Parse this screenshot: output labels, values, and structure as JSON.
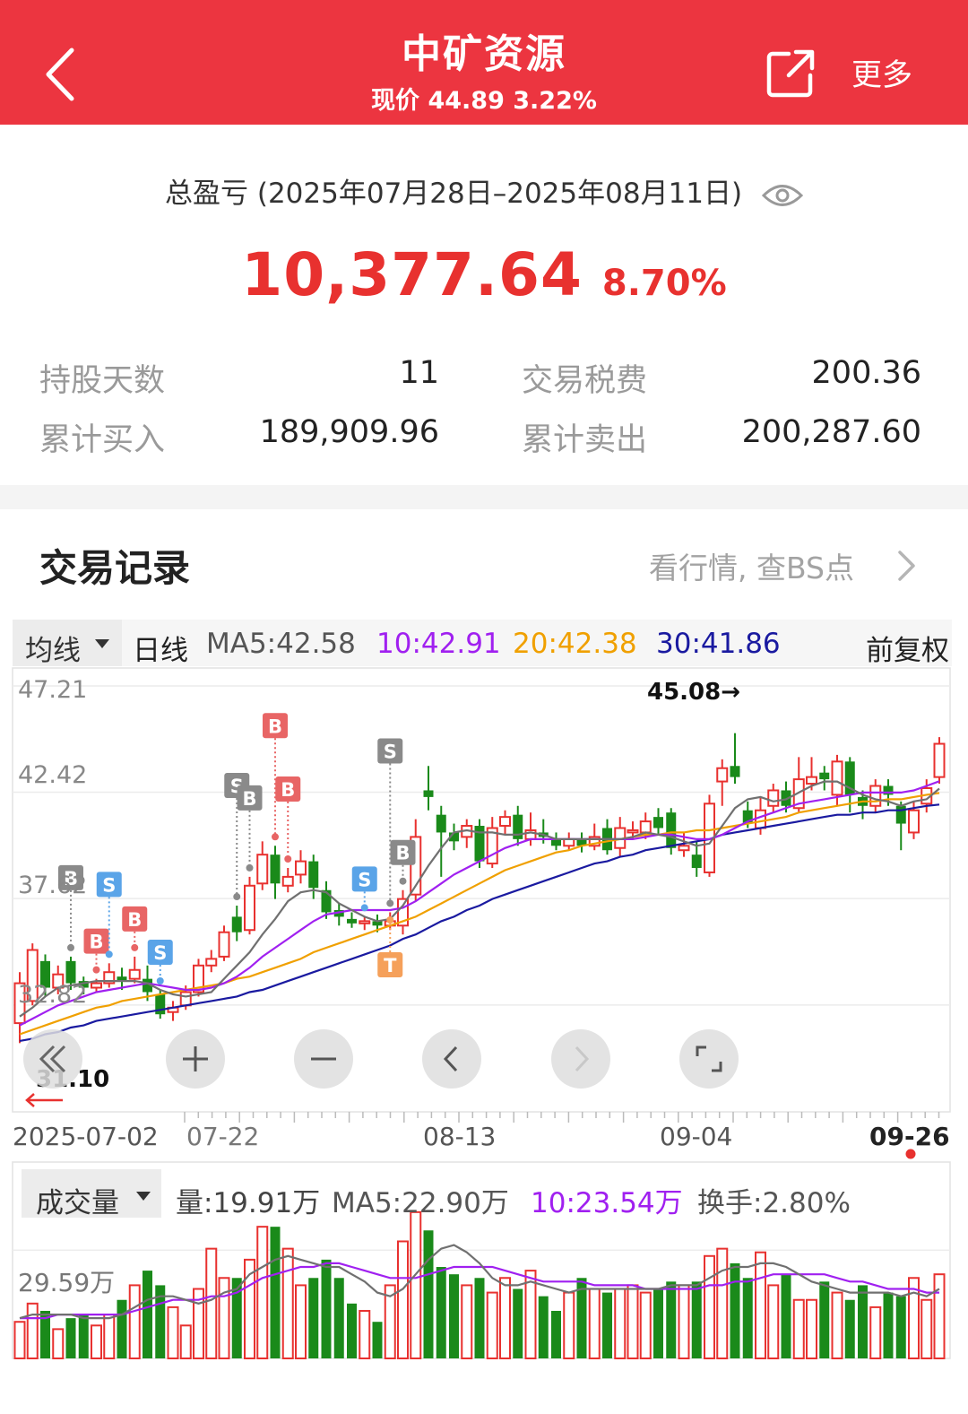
{
  "header": {
    "title": "中矿资源",
    "subtitle": "现价 44.89 3.22%",
    "more_label": "更多"
  },
  "summary": {
    "range_label": "总盈亏 (2025年07月28日–2025年08月11日)",
    "amount": "10,377.64",
    "percent": "8.70%",
    "stats": [
      {
        "label": "持股天数",
        "value": "11"
      },
      {
        "label": "交易税费",
        "value": "200.36"
      },
      {
        "label": "累计买入",
        "value": "189,909.96"
      },
      {
        "label": "累计卖出",
        "value": "200,287.60"
      }
    ]
  },
  "trades": {
    "title": "交易记录",
    "link_label": "看行情, 查BS点"
  },
  "kline": {
    "ma_selector": "均线",
    "period": "日线",
    "ma5": "MA5:42.58",
    "ma10": "10:42.91",
    "ma20": "20:42.38",
    "ma30": "30:41.86",
    "adjust": "前复权",
    "y_labels": [
      "47.21",
      "42.42",
      "37.62",
      "32.82"
    ],
    "low_label": "31.10",
    "high_label": "45.08→",
    "x_labels": [
      "2025-07-02",
      "07-22",
      "08-13",
      "09-04",
      "09-26"
    ],
    "colors": {
      "up": "#e8312f",
      "down": "#1a8a1a",
      "ma5": "#707070",
      "ma10": "#a020f0",
      "ma20": "#f0a000",
      "ma30": "#1a1aa0",
      "buy": "#e86565",
      "sell": "#5aa4e8",
      "gray": "#8a8a8a",
      "tag_t": "#f5a05a"
    },
    "chart_data": {
      "type": "candlestick",
      "y_range": [
        28.0,
        47.21
      ],
      "high": 45.08,
      "low": 31.1,
      "candles": [
        {
          "o": 32.0,
          "c": 33.8,
          "h": 34.3,
          "l": 31.1
        },
        {
          "o": 33.0,
          "c": 35.3,
          "h": 35.6,
          "l": 32.8
        },
        {
          "o": 34.8,
          "c": 33.6,
          "h": 35.1,
          "l": 33.2
        },
        {
          "o": 33.6,
          "c": 34.2,
          "h": 34.6,
          "l": 33.3
        },
        {
          "o": 34.8,
          "c": 33.8,
          "h": 35.0,
          "l": 33.5
        },
        {
          "o": 33.9,
          "c": 33.6,
          "h": 34.1,
          "l": 33.3
        },
        {
          "o": 33.6,
          "c": 33.8,
          "h": 34.0,
          "l": 33.4
        },
        {
          "o": 33.8,
          "c": 34.3,
          "h": 34.7,
          "l": 33.6
        },
        {
          "o": 34.1,
          "c": 33.9,
          "h": 34.5,
          "l": 33.5
        },
        {
          "o": 34.0,
          "c": 34.4,
          "h": 35.0,
          "l": 33.8
        },
        {
          "o": 34.0,
          "c": 33.4,
          "h": 34.6,
          "l": 33.0
        },
        {
          "o": 33.3,
          "c": 32.4,
          "h": 33.5,
          "l": 32.2
        },
        {
          "o": 32.5,
          "c": 32.7,
          "h": 33.0,
          "l": 32.1
        },
        {
          "o": 32.8,
          "c": 33.4,
          "h": 33.7,
          "l": 32.6
        },
        {
          "o": 33.4,
          "c": 34.6,
          "h": 34.9,
          "l": 33.2
        },
        {
          "o": 34.6,
          "c": 34.9,
          "h": 35.3,
          "l": 34.3
        },
        {
          "o": 35.0,
          "c": 36.1,
          "h": 36.4,
          "l": 34.8
        },
        {
          "o": 36.8,
          "c": 36.1,
          "h": 37.3,
          "l": 35.7
        },
        {
          "o": 36.2,
          "c": 38.2,
          "h": 38.6,
          "l": 36.0
        },
        {
          "o": 38.3,
          "c": 39.6,
          "h": 40.2,
          "l": 38.0
        },
        {
          "o": 39.6,
          "c": 38.3,
          "h": 40.0,
          "l": 37.6
        },
        {
          "o": 38.2,
          "c": 38.6,
          "h": 39.0,
          "l": 37.9
        },
        {
          "o": 38.7,
          "c": 39.3,
          "h": 39.8,
          "l": 38.3
        },
        {
          "o": 39.3,
          "c": 38.1,
          "h": 39.6,
          "l": 37.6
        },
        {
          "o": 38.0,
          "c": 37.0,
          "h": 38.4,
          "l": 36.7
        },
        {
          "o": 37.1,
          "c": 36.8,
          "h": 37.4,
          "l": 36.4
        },
        {
          "o": 36.7,
          "c": 36.5,
          "h": 37.0,
          "l": 36.3
        },
        {
          "o": 36.5,
          "c": 36.6,
          "h": 36.8,
          "l": 36.2
        },
        {
          "o": 36.6,
          "c": 36.4,
          "h": 36.9,
          "l": 36.1
        },
        {
          "o": 36.4,
          "c": 36.6,
          "h": 37.0,
          "l": 36.2
        },
        {
          "o": 36.4,
          "c": 37.6,
          "h": 38.0,
          "l": 36.0
        },
        {
          "o": 37.8,
          "c": 40.4,
          "h": 41.2,
          "l": 37.5
        },
        {
          "o": 42.5,
          "c": 42.2,
          "h": 43.6,
          "l": 41.6
        },
        {
          "o": 41.4,
          "c": 40.6,
          "h": 41.8,
          "l": 38.6
        },
        {
          "o": 40.6,
          "c": 40.2,
          "h": 41.0,
          "l": 39.8
        },
        {
          "o": 40.4,
          "c": 40.9,
          "h": 41.2,
          "l": 39.9
        },
        {
          "o": 40.9,
          "c": 39.3,
          "h": 41.2,
          "l": 39.0
        },
        {
          "o": 39.2,
          "c": 40.8,
          "h": 41.3,
          "l": 39.0
        },
        {
          "o": 40.9,
          "c": 41.3,
          "h": 41.6,
          "l": 40.5
        },
        {
          "o": 41.4,
          "c": 40.3,
          "h": 41.8,
          "l": 40.0
        },
        {
          "o": 40.3,
          "c": 40.7,
          "h": 41.5,
          "l": 40.0
        },
        {
          "o": 40.6,
          "c": 40.4,
          "h": 41.2,
          "l": 40.1
        },
        {
          "o": 40.3,
          "c": 40.0,
          "h": 40.6,
          "l": 39.8
        },
        {
          "o": 40.0,
          "c": 40.3,
          "h": 40.6,
          "l": 39.8
        },
        {
          "o": 40.3,
          "c": 40.0,
          "h": 40.6,
          "l": 39.7
        },
        {
          "o": 40.0,
          "c": 40.4,
          "h": 41.0,
          "l": 39.8
        },
        {
          "o": 40.8,
          "c": 39.8,
          "h": 41.2,
          "l": 39.6
        },
        {
          "o": 39.9,
          "c": 40.8,
          "h": 41.3,
          "l": 39.5
        },
        {
          "o": 40.6,
          "c": 40.7,
          "h": 41.1,
          "l": 40.3
        },
        {
          "o": 40.6,
          "c": 41.1,
          "h": 41.5,
          "l": 40.3
        },
        {
          "o": 41.3,
          "c": 40.8,
          "h": 41.7,
          "l": 40.5
        },
        {
          "o": 41.5,
          "c": 39.9,
          "h": 41.7,
          "l": 39.6
        },
        {
          "o": 39.8,
          "c": 40.0,
          "h": 40.6,
          "l": 39.5
        },
        {
          "o": 39.6,
          "c": 39.0,
          "h": 40.2,
          "l": 38.6
        },
        {
          "o": 38.8,
          "c": 41.9,
          "h": 42.3,
          "l": 38.6
        },
        {
          "o": 42.9,
          "c": 43.5,
          "h": 43.9,
          "l": 41.8
        },
        {
          "o": 43.6,
          "c": 43.1,
          "h": 45.08,
          "l": 42.8
        },
        {
          "o": 41.6,
          "c": 41.0,
          "h": 42.0,
          "l": 40.8
        },
        {
          "o": 40.8,
          "c": 41.6,
          "h": 42.2,
          "l": 40.5
        },
        {
          "o": 41.8,
          "c": 42.5,
          "h": 42.8,
          "l": 41.5
        },
        {
          "o": 42.5,
          "c": 41.8,
          "h": 42.9,
          "l": 41.5
        },
        {
          "o": 41.7,
          "c": 43.0,
          "h": 44.0,
          "l": 41.5
        },
        {
          "o": 42.8,
          "c": 43.1,
          "h": 44.0,
          "l": 42.5
        },
        {
          "o": 43.3,
          "c": 43.0,
          "h": 43.6,
          "l": 42.5
        },
        {
          "o": 42.3,
          "c": 43.8,
          "h": 44.1,
          "l": 41.8
        },
        {
          "o": 43.8,
          "c": 42.3,
          "h": 44.0,
          "l": 41.5
        },
        {
          "o": 42.2,
          "c": 41.8,
          "h": 42.5,
          "l": 41.2
        },
        {
          "o": 41.8,
          "c": 42.7,
          "h": 43.0,
          "l": 41.5
        },
        {
          "o": 42.7,
          "c": 42.3,
          "h": 43.0,
          "l": 41.8
        },
        {
          "o": 41.8,
          "c": 41.0,
          "h": 42.0,
          "l": 39.8
        },
        {
          "o": 40.6,
          "c": 41.6,
          "h": 42.0,
          "l": 40.3
        },
        {
          "o": 41.9,
          "c": 42.6,
          "h": 43.0,
          "l": 41.5
        },
        {
          "o": 43.1,
          "c": 44.6,
          "h": 44.9,
          "l": 42.8
        }
      ],
      "ma5": [
        32.3,
        32.7,
        33.2,
        33.6,
        33.7,
        33.8,
        33.9,
        33.9,
        33.9,
        33.9,
        33.8,
        33.5,
        33.3,
        33.2,
        33.3,
        33.4,
        34.0,
        34.6,
        35.2,
        36.0,
        36.7,
        37.5,
        37.9,
        38.0,
        37.9,
        37.4,
        37.1,
        36.8,
        36.6,
        36.7,
        37.3,
        38.2,
        39.1,
        39.9,
        40.6,
        40.7,
        40.6,
        40.6,
        40.5,
        40.5,
        40.6,
        40.5,
        40.3,
        40.3,
        40.3,
        40.3,
        40.3,
        40.3,
        40.4,
        40.6,
        40.5,
        40.4,
        40.2,
        40.0,
        40.1,
        40.9,
        41.7,
        42.1,
        42.2,
        42.0,
        42.1,
        42.4,
        42.7,
        42.9,
        42.9,
        42.6,
        42.3,
        42.1,
        42.0,
        41.8,
        42.0,
        42.1,
        42.58
      ],
      "ma10": [
        31.9,
        32.2,
        32.5,
        32.8,
        33.0,
        33.2,
        33.4,
        33.5,
        33.6,
        33.7,
        33.8,
        33.7,
        33.6,
        33.5,
        33.5,
        33.6,
        33.8,
        34.1,
        34.5,
        35.0,
        35.4,
        35.8,
        36.2,
        36.6,
        36.9,
        37.0,
        37.1,
        37.1,
        37.1,
        37.1,
        37.2,
        37.5,
        37.9,
        38.3,
        38.7,
        39.0,
        39.3,
        39.6,
        39.9,
        40.1,
        40.3,
        40.3,
        40.3,
        40.3,
        40.3,
        40.3,
        40.3,
        40.3,
        40.3,
        40.4,
        40.5,
        40.5,
        40.4,
        40.3,
        40.3,
        40.5,
        40.8,
        41.1,
        41.3,
        41.5,
        41.7,
        41.9,
        42.0,
        42.1,
        42.2,
        42.3,
        42.4,
        42.4,
        42.4,
        42.4,
        42.5,
        42.7,
        42.91
      ],
      "ma20": [
        31.5,
        31.7,
        31.9,
        32.1,
        32.3,
        32.5,
        32.7,
        32.8,
        33.0,
        33.1,
        33.2,
        33.3,
        33.4,
        33.5,
        33.6,
        33.7,
        33.8,
        34.0,
        34.1,
        34.3,
        34.5,
        34.7,
        34.9,
        35.2,
        35.4,
        35.6,
        35.8,
        36.0,
        36.2,
        36.4,
        36.6,
        36.8,
        37.1,
        37.4,
        37.7,
        38.0,
        38.3,
        38.6,
        38.9,
        39.1,
        39.3,
        39.5,
        39.7,
        39.8,
        40.0,
        40.1,
        40.2,
        40.3,
        40.4,
        40.5,
        40.5,
        40.6,
        40.6,
        40.7,
        40.7,
        40.8,
        40.9,
        41.0,
        41.1,
        41.2,
        41.3,
        41.5,
        41.6,
        41.7,
        41.8,
        41.9,
        42.0,
        42.0,
        42.1,
        42.1,
        42.2,
        42.3,
        42.38
      ],
      "ma30": [
        31.2,
        31.3,
        31.5,
        31.6,
        31.8,
        31.9,
        32.1,
        32.2,
        32.3,
        32.4,
        32.5,
        32.6,
        32.7,
        32.8,
        32.9,
        33.0,
        33.1,
        33.2,
        33.4,
        33.5,
        33.7,
        33.9,
        34.1,
        34.3,
        34.5,
        34.7,
        34.9,
        35.1,
        35.3,
        35.5,
        35.8,
        36.0,
        36.3,
        36.6,
        36.8,
        37.1,
        37.3,
        37.6,
        37.8,
        38.0,
        38.2,
        38.4,
        38.6,
        38.8,
        39.0,
        39.2,
        39.3,
        39.5,
        39.6,
        39.8,
        39.9,
        40.0,
        40.1,
        40.2,
        40.3,
        40.5,
        40.6,
        40.7,
        40.8,
        40.9,
        41.0,
        41.1,
        41.2,
        41.3,
        41.4,
        41.4,
        41.5,
        41.5,
        41.6,
        41.6,
        41.7,
        41.8,
        41.86
      ],
      "markers": [
        {
          "i": 4,
          "t": "B",
          "kind": "gray",
          "lvl": 1
        },
        {
          "i": 6,
          "t": "B",
          "kind": "buy",
          "lvl": 0
        },
        {
          "i": 7,
          "t": "S",
          "kind": "sell",
          "lvl": 1
        },
        {
          "i": 9,
          "t": "B",
          "kind": "buy",
          "lvl": 0
        },
        {
          "i": 11,
          "t": "S",
          "kind": "sell",
          "lvl": 0
        },
        {
          "i": 17,
          "t": "S",
          "kind": "gray",
          "lvl": 2
        },
        {
          "i": 18,
          "t": "B",
          "kind": "gray",
          "lvl": 1
        },
        {
          "i": 20,
          "t": "B",
          "kind": "buy",
          "lvl": 2
        },
        {
          "i": 21,
          "t": "B",
          "kind": "buy",
          "lvl": 1
        },
        {
          "i": 27,
          "t": "S",
          "kind": "sell",
          "lvl": 0
        },
        {
          "i": 29,
          "t": "S",
          "kind": "gray",
          "lvl": 3
        },
        {
          "i": 30,
          "t": "B",
          "kind": "gray",
          "lvl": 0
        }
      ]
    }
  },
  "volume": {
    "selector": "成交量",
    "vol": "量:19.91万",
    "ma5": "MA5:22.90万",
    "ma10": "10:23.54万",
    "turnover": "换手:2.80%",
    "y_label": "29.59万",
    "chart_data": {
      "type": "bar",
      "max": 38,
      "values": [
        10,
        15,
        13,
        8,
        11,
        12,
        9,
        12,
        16,
        20,
        24,
        20,
        14,
        9,
        19,
        30,
        22,
        22,
        27,
        36,
        36,
        30,
        20,
        22,
        27,
        22,
        15,
        13,
        10,
        20,
        32,
        40,
        35,
        25,
        23,
        20,
        22,
        18,
        22,
        19,
        24,
        17,
        13,
        18,
        22,
        19,
        18,
        19,
        20,
        18,
        19,
        21,
        20,
        21,
        28,
        30,
        26,
        22,
        29,
        20,
        23,
        16,
        16,
        21,
        18,
        16,
        20,
        14,
        18,
        17,
        22,
        16,
        23
      ],
      "ma5": [
        11,
        12,
        12,
        12,
        12,
        11,
        11,
        11,
        12,
        14,
        16,
        17,
        17,
        16,
        15,
        16,
        18,
        19,
        23,
        25,
        27,
        28,
        27,
        26,
        25,
        25,
        23,
        21,
        18,
        17,
        19,
        23,
        27,
        30,
        31,
        29,
        26,
        22,
        20,
        20,
        21,
        20,
        19,
        18,
        19,
        19,
        19,
        19,
        19,
        19,
        19,
        20,
        20,
        20,
        22,
        24,
        25,
        25,
        26,
        26,
        25,
        23,
        21,
        20,
        19,
        18,
        18,
        18,
        18,
        17,
        18,
        17,
        19
      ],
      "ma10": [
        11,
        11,
        11,
        12,
        12,
        12,
        12,
        12,
        12,
        13,
        14,
        15,
        16,
        16,
        16,
        17,
        17,
        18,
        20,
        22,
        23,
        24,
        25,
        25,
        26,
        26,
        25,
        24,
        23,
        22,
        22,
        22,
        23,
        24,
        25,
        25,
        25,
        25,
        24,
        23,
        22,
        21,
        21,
        21,
        21,
        20,
        20,
        20,
        20,
        19,
        19,
        19,
        19,
        19,
        20,
        20,
        21,
        21,
        22,
        23,
        23,
        23,
        23,
        23,
        22,
        21,
        21,
        20,
        19,
        19,
        19,
        18,
        18
      ]
    }
  }
}
